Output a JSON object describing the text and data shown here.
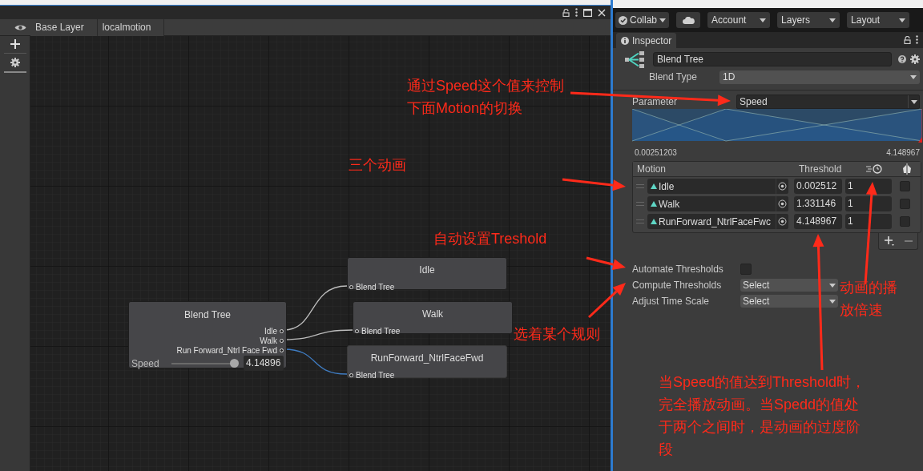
{
  "editor": {
    "breadcrumbs": [
      "Base Layer",
      "localmotion"
    ]
  },
  "graph": {
    "root": {
      "title": "Blend Tree",
      "outputs": [
        "Idle",
        "Walk",
        "Run Forward_Ntrl Face Fwd"
      ],
      "parameter": "Speed",
      "level": 0.95,
      "value": "4.14896"
    },
    "nodes": [
      {
        "title": "Idle",
        "input": "Blend Tree",
        "selected": false
      },
      {
        "title": "Walk",
        "input": "Blend Tree",
        "selected": false
      },
      {
        "title": "RunForward_NtrlFaceFwd",
        "input": "Blend Tree",
        "selected": true
      }
    ]
  },
  "toolbar": {
    "collab": "Collab",
    "account": "Account",
    "layers": "Layers",
    "layout": "Layout"
  },
  "inspector": {
    "tab": "Inspector",
    "name": "Blend Tree",
    "blend_type_label": "Blend Type",
    "blend_type": "1D",
    "parameter_label": "Parameter",
    "parameter": "Speed",
    "range_min": "0.00251203",
    "range_max": "4.148967",
    "motion_header": "Motion",
    "threshold_header": "Threshold",
    "motions": [
      {
        "name": "Idle",
        "threshold": "0.002512",
        "time_scale": "1",
        "mirror": false
      },
      {
        "name": "Walk",
        "threshold": "1.331146",
        "time_scale": "1",
        "mirror": false
      },
      {
        "name": "RunForward_NtrlFaceFwc",
        "threshold": "4.148967",
        "time_scale": "1",
        "mirror": false
      }
    ],
    "automate_label": "Automate Thresholds",
    "automate": false,
    "compute_label": "Compute Thresholds",
    "compute": "Select",
    "adjust_label": "Adjust Time Scale",
    "adjust": "Select"
  },
  "annotations": [
    {
      "text": "通过Speed这个值来控制下面Motion的切换"
    },
    {
      "text": "三个动画"
    },
    {
      "text": "自动设置Treshold"
    },
    {
      "text": "选着某个规则"
    },
    {
      "text": "动画的播放倍速"
    },
    {
      "text": "当Speed的值达到Threshold时，完全播放动画。当Spedd的值处于两个之间时，是动画的过度阶段"
    }
  ]
}
